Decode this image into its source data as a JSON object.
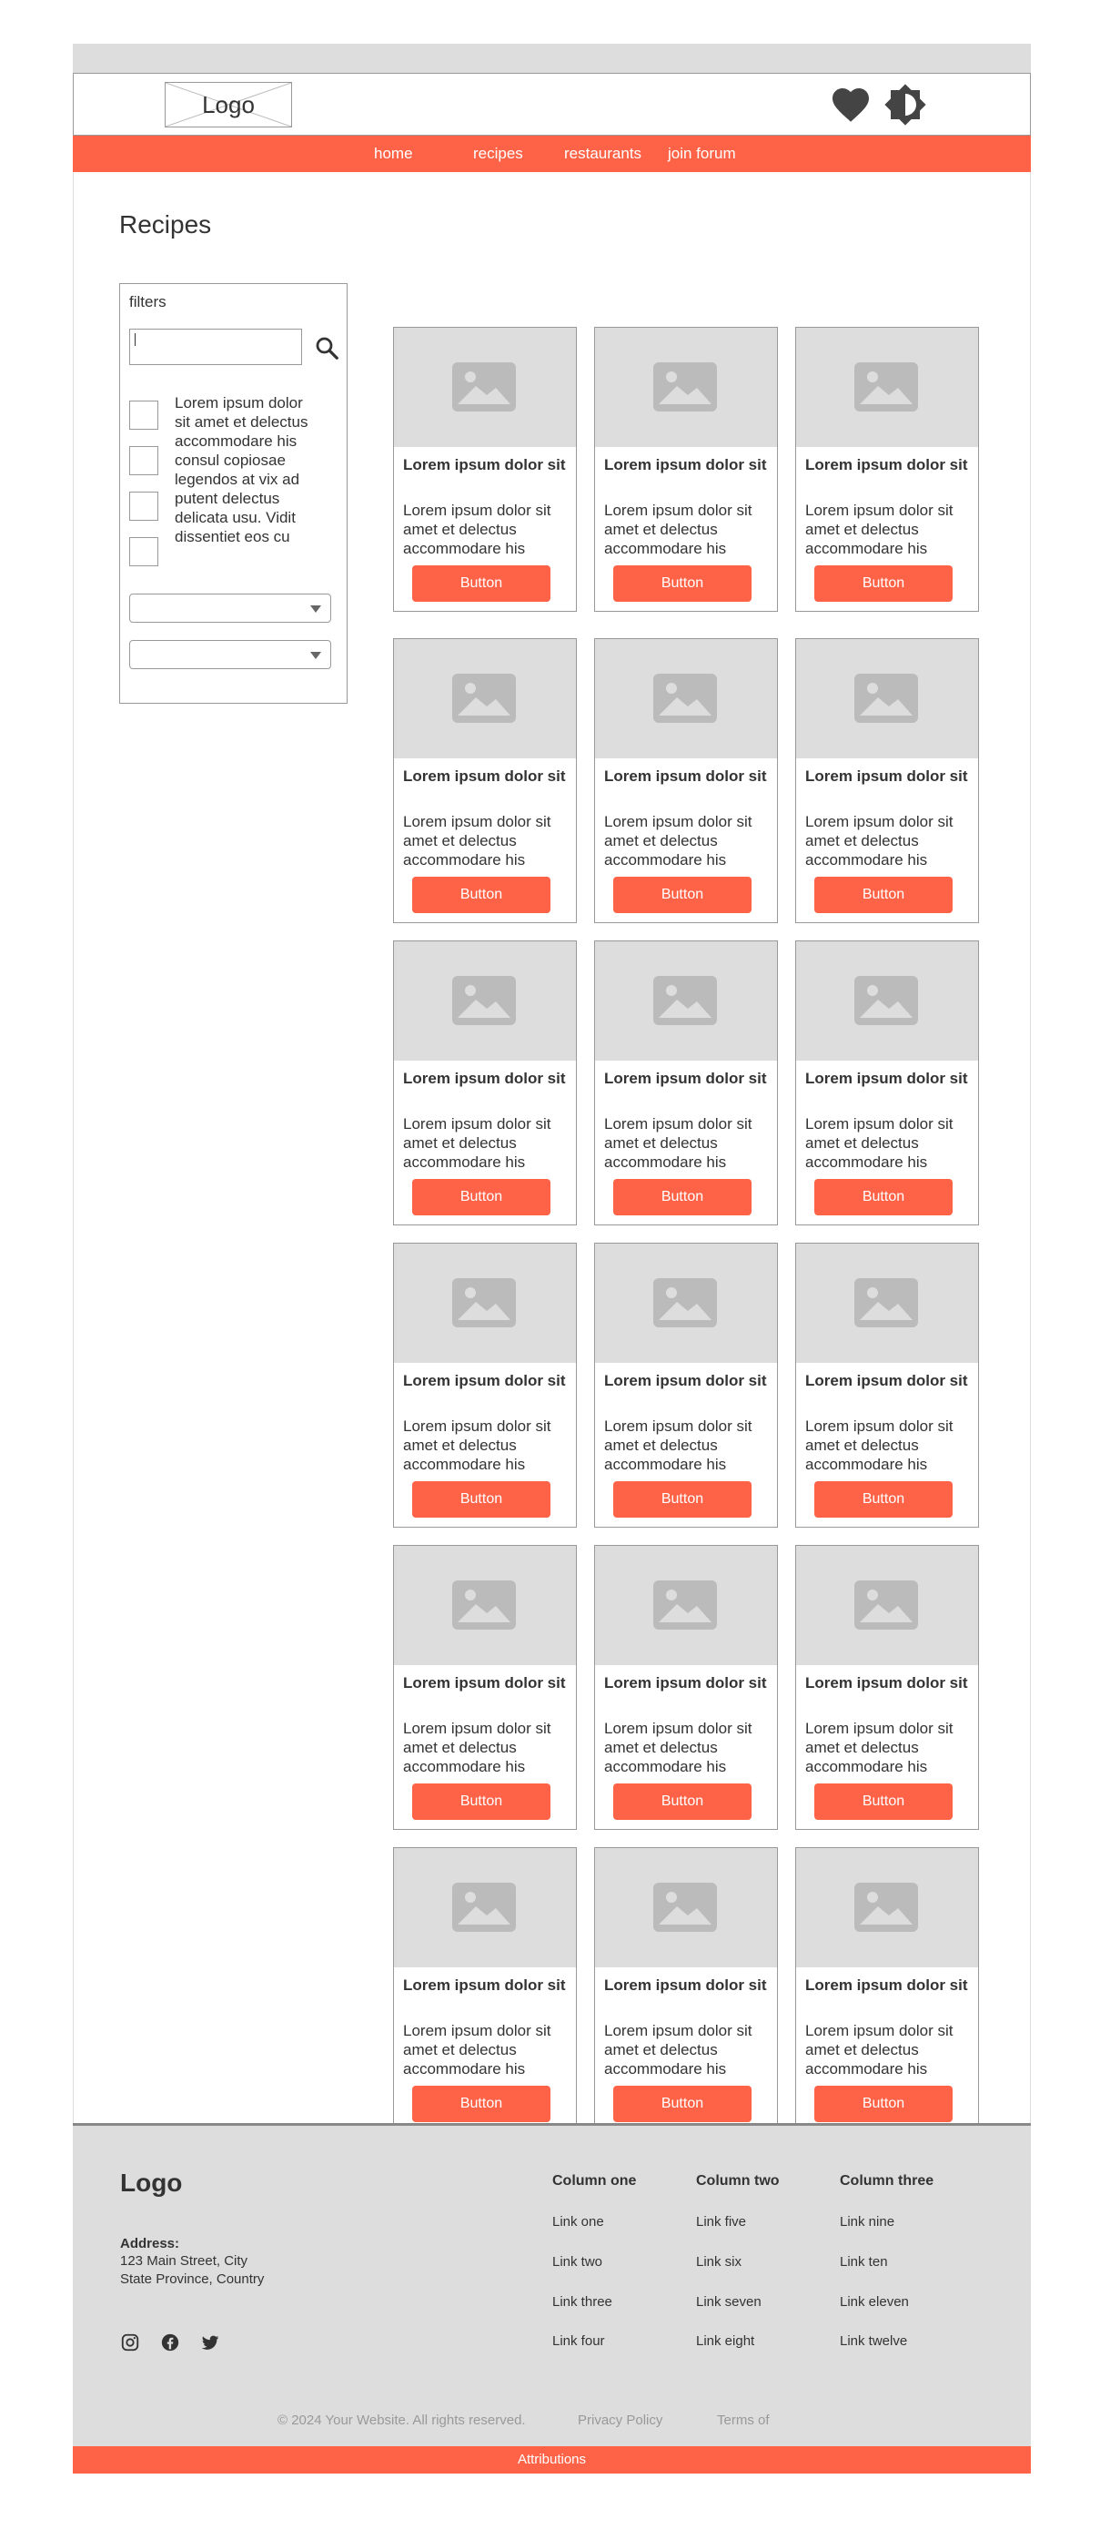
{
  "header": {
    "logo": "Logo",
    "icons": [
      "heart-icon",
      "brightness-icon"
    ]
  },
  "nav": {
    "items": [
      {
        "label": "home"
      },
      {
        "label": "recipes"
      },
      {
        "label": "restaurants"
      },
      {
        "label": "join forum"
      }
    ]
  },
  "main": {
    "title": "Recipes",
    "filters": {
      "title": "filters",
      "search_value": "",
      "checkbox_text": "Lorem ipsum dolor sit amet et delectus accommodare his consul copiosae legendos at vix ad putent delectus delicata usu. Vidit dissentiet eos cu",
      "dropdown1": "",
      "dropdown2": ""
    },
    "cards": [
      {
        "title": "Lorem ipsum dolor sit",
        "body": "Lorem ipsum dolor sit amet et delectus accommodare his",
        "button": "Button"
      },
      {
        "title": "Lorem ipsum dolor sit",
        "body": "Lorem ipsum dolor sit amet et delectus accommodare his",
        "button": "Button"
      },
      {
        "title": "Lorem ipsum dolor sit",
        "body": "Lorem ipsum dolor sit amet et delectus accommodare his",
        "button": "Button"
      },
      {
        "title": "Lorem ipsum dolor sit",
        "body": "Lorem ipsum dolor sit amet et delectus accommodare his",
        "button": "Button"
      },
      {
        "title": "Lorem ipsum dolor sit",
        "body": "Lorem ipsum dolor sit amet et delectus accommodare his",
        "button": "Button"
      },
      {
        "title": "Lorem ipsum dolor sit",
        "body": "Lorem ipsum dolor sit amet et delectus accommodare his",
        "button": "Button"
      },
      {
        "title": "Lorem ipsum dolor sit",
        "body": "Lorem ipsum dolor sit amet et delectus accommodare his",
        "button": "Button"
      },
      {
        "title": "Lorem ipsum dolor sit",
        "body": "Lorem ipsum dolor sit amet et delectus accommodare his",
        "button": "Button"
      },
      {
        "title": "Lorem ipsum dolor sit",
        "body": "Lorem ipsum dolor sit amet et delectus accommodare his",
        "button": "Button"
      },
      {
        "title": "Lorem ipsum dolor sit",
        "body": "Lorem ipsum dolor sit amet et delectus accommodare his",
        "button": "Button"
      },
      {
        "title": "Lorem ipsum dolor sit",
        "body": "Lorem ipsum dolor sit amet et delectus accommodare his",
        "button": "Button"
      },
      {
        "title": "Lorem ipsum dolor sit",
        "body": "Lorem ipsum dolor sit amet et delectus accommodare his",
        "button": "Button"
      },
      {
        "title": "Lorem ipsum dolor sit",
        "body": "Lorem ipsum dolor sit amet et delectus accommodare his",
        "button": "Button"
      },
      {
        "title": "Lorem ipsum dolor sit",
        "body": "Lorem ipsum dolor sit amet et delectus accommodare his",
        "button": "Button"
      },
      {
        "title": "Lorem ipsum dolor sit",
        "body": "Lorem ipsum dolor sit amet et delectus accommodare his",
        "button": "Button"
      },
      {
        "title": "Lorem ipsum dolor sit",
        "body": "Lorem ipsum dolor sit amet et delectus accommodare his",
        "button": "Button"
      },
      {
        "title": "Lorem ipsum dolor sit",
        "body": "Lorem ipsum dolor sit amet et delectus accommodare his",
        "button": "Button"
      },
      {
        "title": "Lorem ipsum dolor sit",
        "body": "Lorem ipsum dolor sit amet et delectus accommodare his",
        "button": "Button"
      }
    ]
  },
  "footer": {
    "logo": "Logo",
    "address_label": "Address:",
    "address_line1": "123 Main Street, City",
    "address_line2": "State Province, Country",
    "social_icons": [
      "instagram-icon",
      "facebook-icon",
      "twitter-icon"
    ],
    "columns": [
      {
        "heading": "Column one",
        "links": [
          "Link one",
          "Link two",
          "Link three",
          "Link four"
        ]
      },
      {
        "heading": "Column two",
        "links": [
          "Link five",
          "Link six",
          "Link seven",
          "Link eight"
        ]
      },
      {
        "heading": "Column three",
        "links": [
          "Link nine",
          "Link ten",
          "Link eleven",
          "Link twelve"
        ]
      }
    ],
    "copyright": "© 2024 Your Website. All rights reserved.",
    "privacy": "Privacy Policy",
    "terms": "Terms of",
    "attributions": "Attributions"
  },
  "colors": {
    "accent": "#ff6347",
    "placeholder_gray": "#dddddd",
    "border": "#999999"
  }
}
